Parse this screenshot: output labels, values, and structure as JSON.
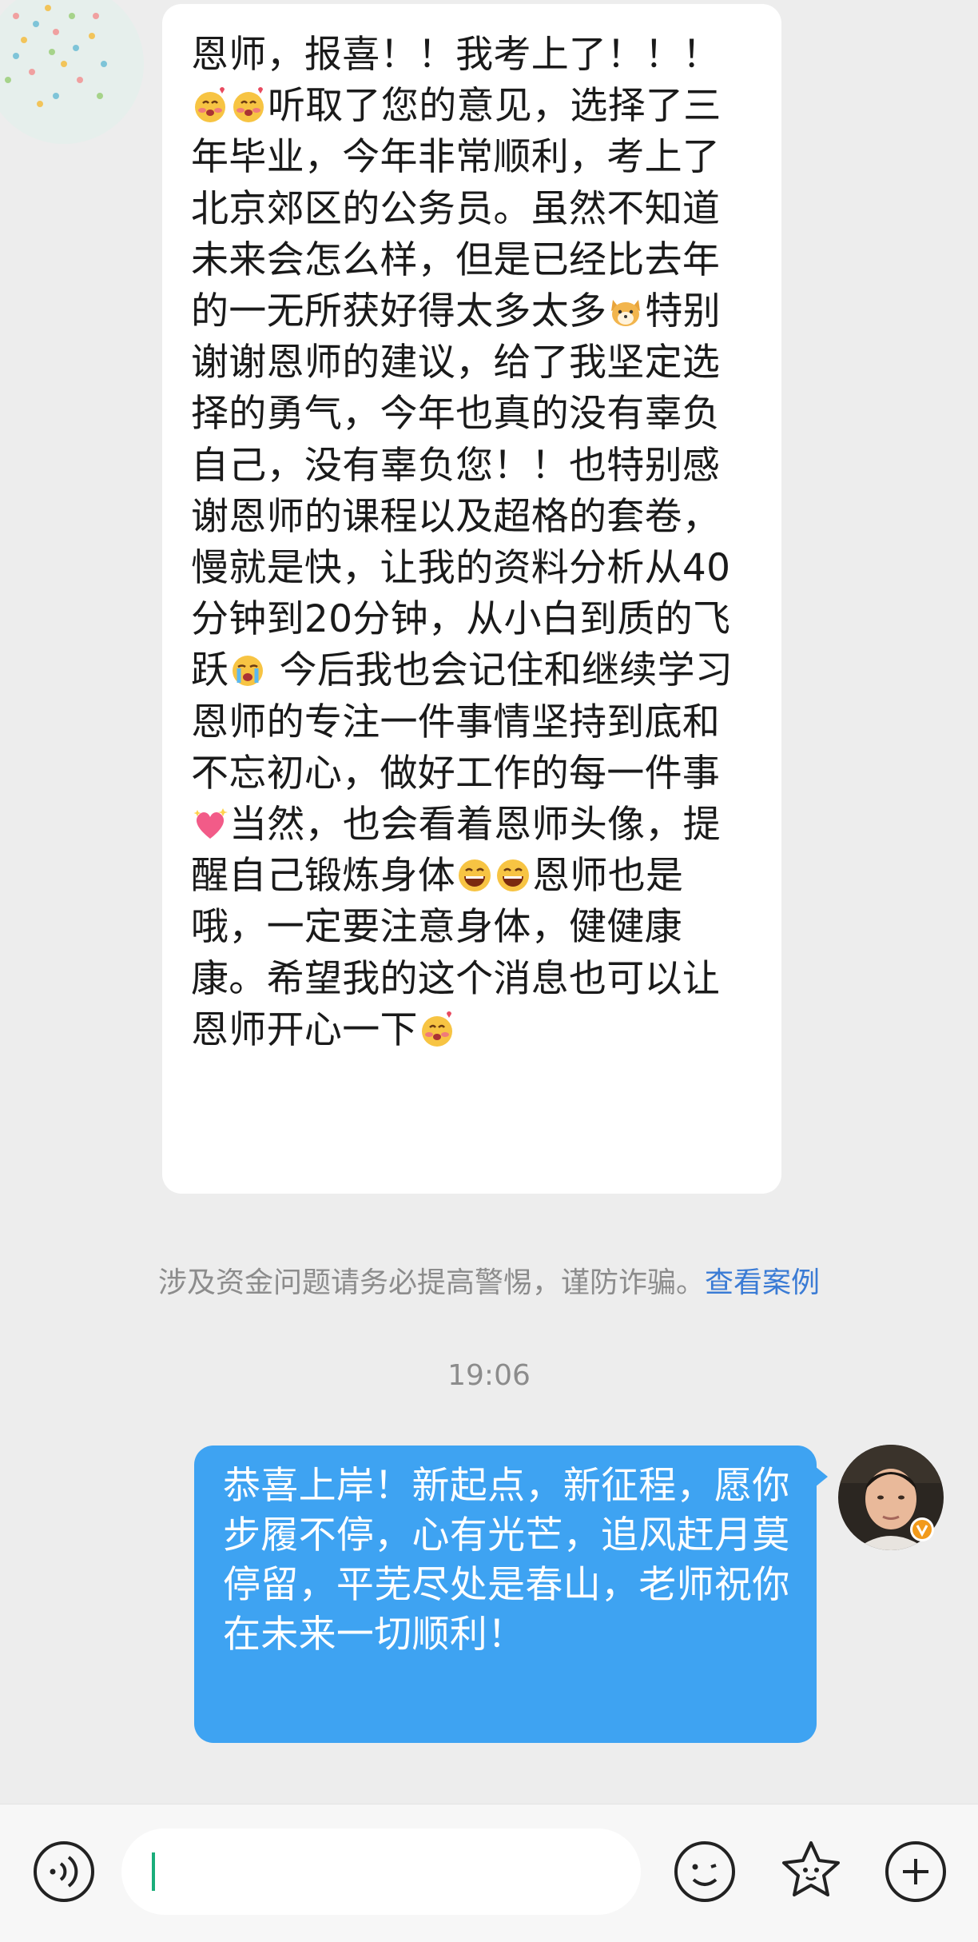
{
  "chat": {
    "incoming_message": {
      "text_before_emoji1": "恩师，报喜！！我考上了！！！",
      "emoji1": "blushing-face-emoji",
      "emoji2": "blushing-face-emoji",
      "text_after_emoji2": "听取了您的意见，选择了三年毕业，今年非常顺利，考上了北京郊区的公务员。虽然不知道未来会怎么样，但是已经比去年的一无所获好得太多太多",
      "emoji3": "shiba-dog-emoji",
      "text_after_emoji3": "特别谢谢恩师的建议，给了我坚定选择的勇气，今年也真的没有辜负自己，没有辜负您！！也特别感谢恩师的课程以及超格的套卷，慢就是快，让我的资料分析从40分钟到20分钟，从小白到质的飞跃",
      "emoji4": "crying-face-emoji",
      "text_after_emoji4": " 今后我也会记住和继续学习恩师的专注一件事情坚持到底和不忘初心，做好工作的每一件事",
      "emoji5": "heart-emoji",
      "text_after_emoji5": "当然，也会看着恩师头像，提醒自己锻炼身体",
      "emoji6": "grinning-face-emoji",
      "emoji7": "grinning-face-emoji",
      "text_after_emoji7": "恩师也是哦，一定要注意身体，健健康康。希望我的这个消息也可以让恩师开心一下",
      "emoji8": "blushing-face-emoji"
    },
    "system_notice": {
      "text": "涉及资金问题请务必提高警惕，谨防诈骗。",
      "link": "查看案例"
    },
    "timestamp": "19:06",
    "outgoing_message": {
      "text": "恭喜上岸！新起点，新征程，愿你步履不停，心有光芒，追风赶月莫停留，平芜尽处是春山，老师祝你在未来一切顺利！"
    }
  },
  "input_bar": {
    "voice_icon": "voice-input-icon",
    "emoji_icon": "emoji-icon",
    "sticker_icon": "sticker-star-icon",
    "add_icon": "plus-icon",
    "placeholder": ""
  },
  "colors": {
    "background": "#ededed",
    "incoming_bubble": "#ffffff",
    "outgoing_bubble": "#3ea3f2",
    "link": "#3a7bd5",
    "caret": "#1aad7a"
  }
}
